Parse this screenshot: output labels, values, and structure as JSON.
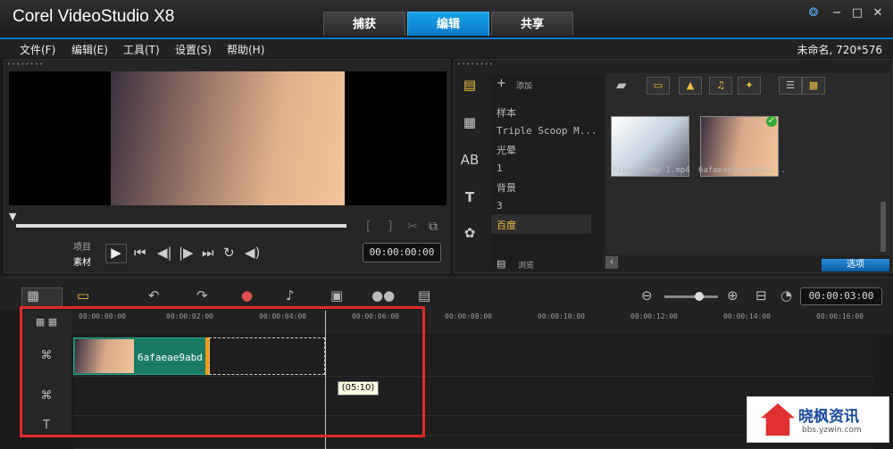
{
  "app": {
    "title": "Corel VideoStudio X8",
    "project": "未命名, 720*576"
  },
  "tabs": [
    "捕获",
    "编辑",
    "共享"
  ],
  "menu": [
    "文件(F)",
    "编辑(E)",
    "工具(T)",
    "设置(S)",
    "帮助(H)"
  ],
  "preview": {
    "mode_project": "项目",
    "mode_clip": "素材",
    "timecode": "00:00:00:00"
  },
  "library": {
    "add_label": "添加",
    "folders": [
      "样本",
      "Triple Scoop M...",
      "光晕",
      "1",
      "背景",
      "3",
      "百度"
    ],
    "browse_label": "浏览",
    "thumbs": [
      "Final Comp`1.mp4",
      "6afaeae9abddb41..."
    ],
    "options_label": "选项"
  },
  "timeline": {
    "timecode": "00:00:03:00",
    "ruler": [
      "00:00:00:00",
      "00:00:02:00",
      "00:00:04:00",
      "00:00:06:00",
      "00:00:08:00",
      "00:00:10:00",
      "00:00:12:00",
      "00:00:14:00",
      "00:00:16:00"
    ],
    "clip_name": "6afaeae9abd",
    "tooltip": "(05:10)"
  },
  "watermark": {
    "name": "晓枫资讯",
    "url": "bbs.yzwin.com"
  },
  "colors": {
    "accent": "#0a78c8",
    "highlight_box": "#e02a2a",
    "clip": "#1a7a66"
  }
}
